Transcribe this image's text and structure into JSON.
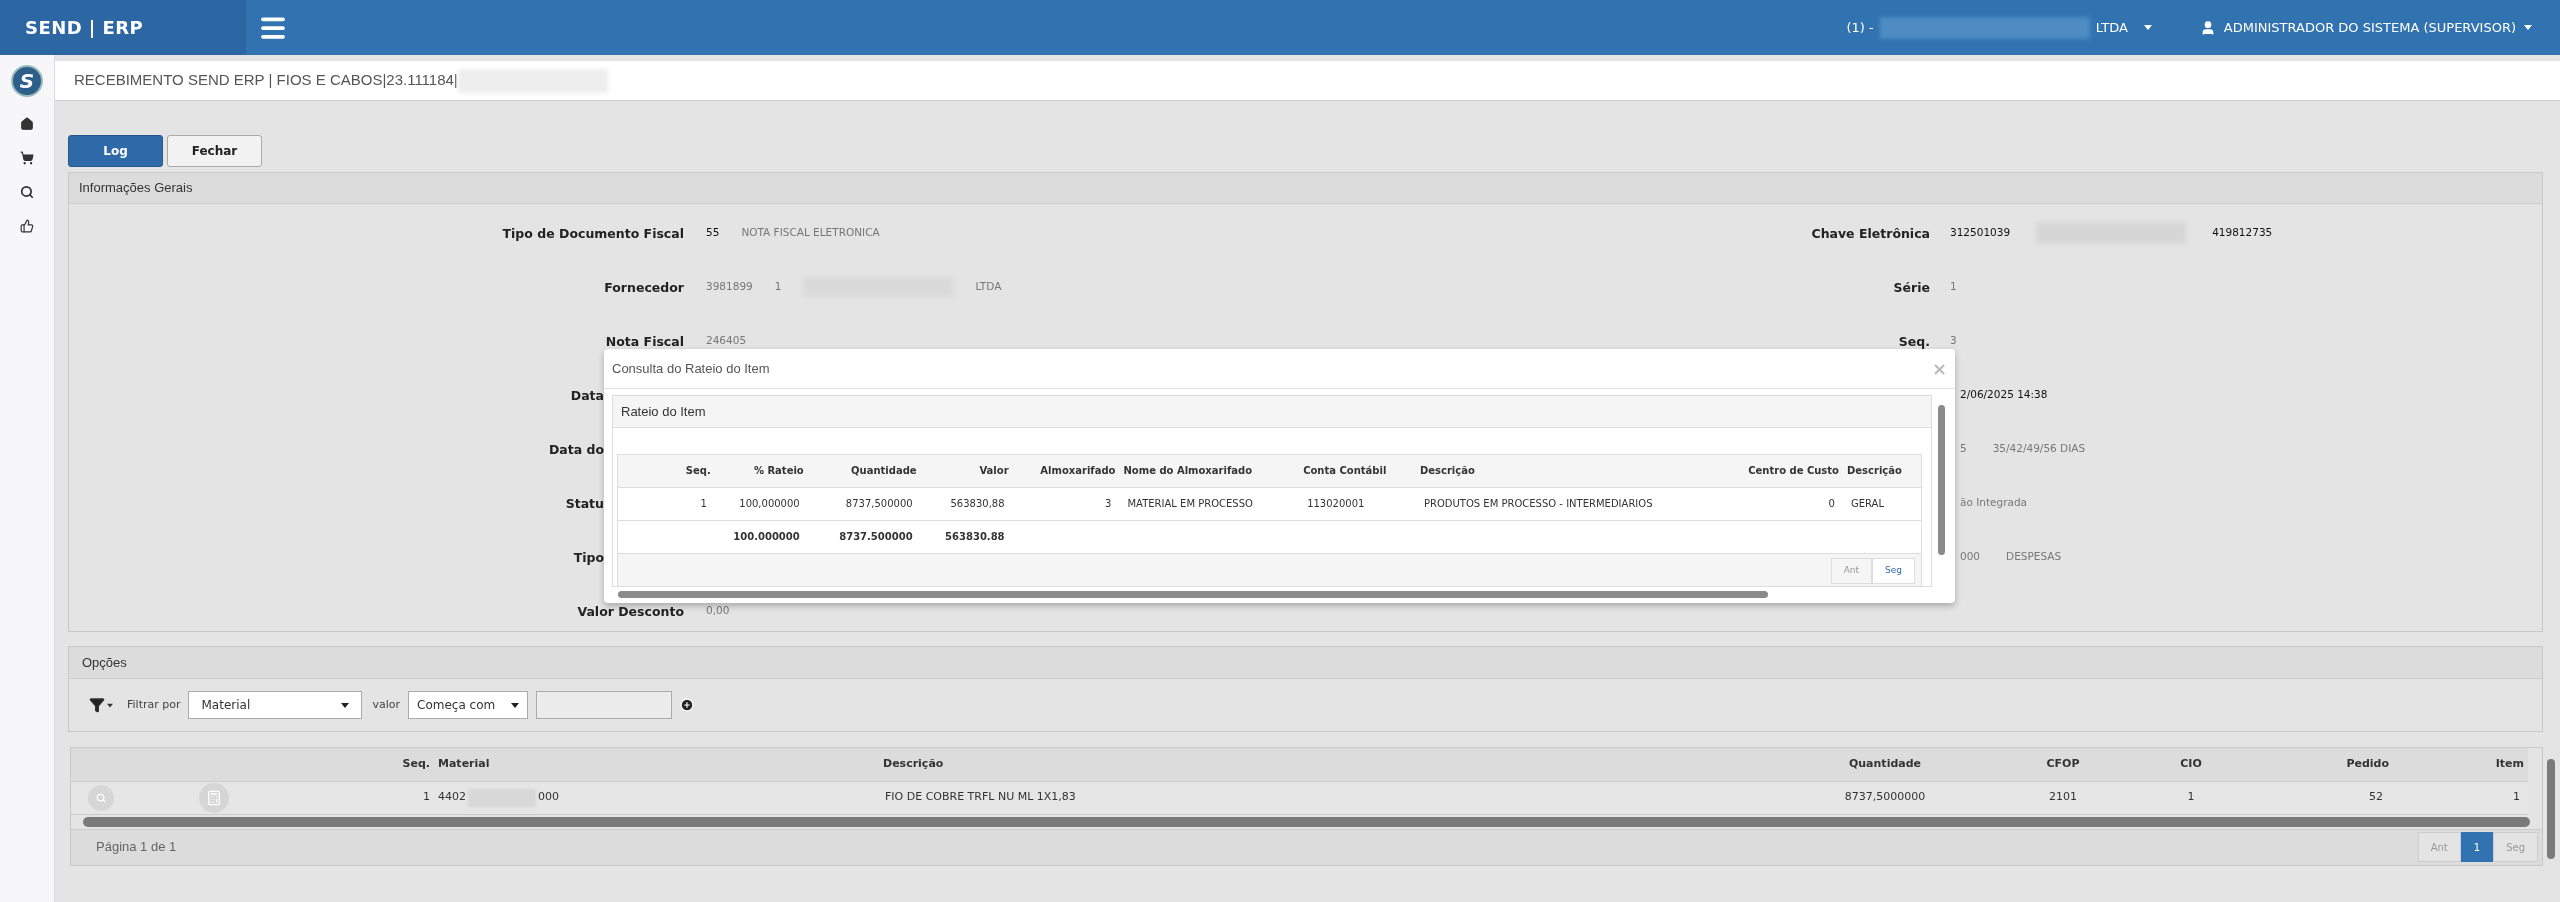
{
  "topbar": {
    "brand": "SEND | ERP",
    "company": [
      {
        "kind": "text",
        "text": "(1) -"
      },
      {
        "kind": "redacted"
      },
      {
        "kind": "text",
        "text": "LTDA"
      }
    ],
    "user": "ADMINISTRADOR DO SISTEMA (SUPERVISOR)"
  },
  "sidebar": {
    "logo": "S"
  },
  "page_title": [
    {
      "kind": "text",
      "text": "RECEBIMENTO SEND ERP | FIOS E CABOS|23.111184|"
    },
    {
      "kind": "redacted"
    }
  ],
  "buttons": [
    {
      "label": "Log",
      "kind": "primary"
    },
    {
      "label": "Fechar",
      "kind": "default"
    }
  ],
  "general_info": {
    "title": "Informações Gerais",
    "rows": [
      {
        "left": {
          "label": "Tipo de Documento Fiscal",
          "values": [
            {
              "kind": "code",
              "text": "55"
            },
            {
              "kind": "text",
              "text": "NOTA FISCAL ELETRONICA"
            }
          ]
        },
        "right": {
          "label": "Chave Eletrônica",
          "values": [
            {
              "kind": "code",
              "text": "312501039"
            },
            {
              "kind": "redacted"
            },
            {
              "kind": "code",
              "text": "419812735"
            }
          ]
        }
      },
      {
        "left": {
          "label": "Fornecedor",
          "values": [
            {
              "kind": "text",
              "text": "3981899"
            },
            {
              "kind": "text",
              "text": "1"
            },
            {
              "kind": "redacted"
            },
            {
              "kind": "text",
              "text": "LTDA"
            }
          ]
        },
        "right": {
          "label": "Série",
          "values": [
            {
              "kind": "text",
              "text": "1"
            }
          ]
        }
      },
      {
        "left": {
          "label": "Nota Fiscal",
          "values": [
            {
              "kind": "text",
              "text": "246405"
            }
          ]
        },
        "right": {
          "label": "Seq.",
          "values": [
            {
              "kind": "text",
              "text": "3"
            }
          ]
        }
      },
      {
        "left": {
          "label": "Data"
        },
        "right": {
          "values": [
            {
              "kind": "code",
              "text": "2/06/2025 14:38"
            }
          ]
        }
      },
      {
        "left": {
          "label": "Data do"
        },
        "right": {
          "values": [
            {
              "kind": "text",
              "text": "5"
            },
            {
              "kind": "text",
              "text": "35/42/49/56 DIAS"
            }
          ]
        }
      },
      {
        "left": {
          "label": "Statu"
        },
        "right": {
          "values": [
            {
              "kind": "text",
              "text": "ão Integrada"
            }
          ]
        }
      },
      {
        "left": {
          "label": "Tipo"
        },
        "right": {
          "values": [
            {
              "kind": "text",
              "text": "000"
            },
            {
              "kind": "text",
              "text": "DESPESAS"
            }
          ]
        }
      },
      {
        "left": {
          "label": "Valor Desconto",
          "values": [
            {
              "kind": "text",
              "text": "0,00"
            }
          ]
        }
      }
    ]
  },
  "options": {
    "title": "Opções",
    "filter_label": "Filtrar por",
    "field": "Material",
    "value_label": "valor",
    "operator": "Começa com"
  },
  "grid": {
    "columns": [
      "Seq.",
      "Material",
      "Descrição",
      "Quantidade",
      "CFOP",
      "CIO",
      "Pedido",
      "Item"
    ],
    "rows": [
      {
        "seq": "1",
        "material": [
          {
            "kind": "text",
            "text": "4402"
          },
          {
            "kind": "redacted"
          },
          {
            "kind": "text",
            "text": "000"
          }
        ],
        "description": "FIO DE COBRE TRFL NU ML 1X1,83",
        "quantity": "8737,5000000",
        "cfop": "2101",
        "cio": "1",
        "order": "52",
        "item": "1"
      }
    ],
    "footer": "Página 1 de 1",
    "pager": [
      {
        "label": "Ant",
        "selected": false
      },
      {
        "label": "1",
        "selected": true
      },
      {
        "label": "Seg",
        "selected": false
      }
    ]
  },
  "modal": {
    "title": "Consulta do Rateio do Item",
    "close": "×",
    "panel_title": "Rateio do Item",
    "columns": [
      "Seq.",
      "% Rateio",
      "Quantidade",
      "Valor",
      "Almoxarifado",
      "Nome do Almoxarifado",
      "Conta Contábil",
      "Descrição",
      "Centro de Custo",
      "Descrição"
    ],
    "rows": [
      [
        "1",
        "100,000000",
        "8737,500000",
        "563830,88",
        "3",
        "MATERIAL EM PROCESSO",
        "113020001",
        "PRODUTOS EM PROCESSO - INTERMEDIARIOS",
        "0",
        "GERAL"
      ]
    ],
    "totals": {
      "rateio": "100.000000",
      "quantidade": "8737.500000",
      "valor": "563830.88"
    },
    "pager": [
      {
        "label": "Ant",
        "disabled": true
      },
      {
        "label": "Seg",
        "disabled": false
      }
    ]
  }
}
